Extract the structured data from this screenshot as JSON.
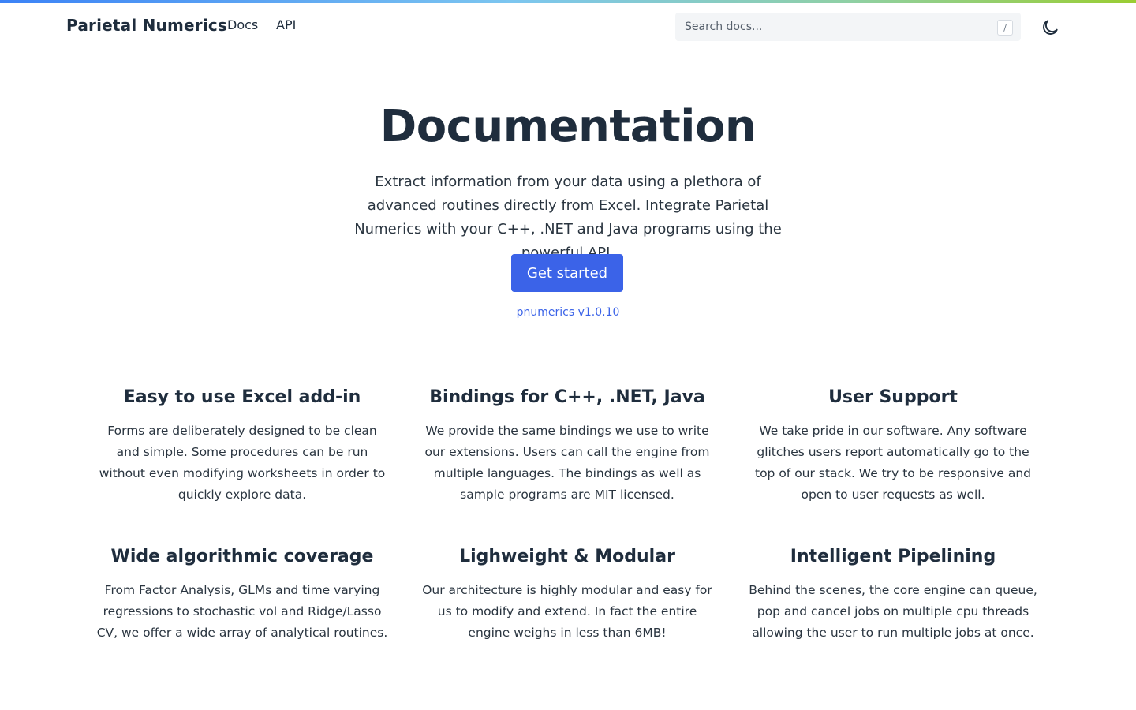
{
  "header": {
    "brand": "Parietal Numerics",
    "nav": [
      {
        "label": "Docs"
      },
      {
        "label": "API"
      }
    ],
    "search": {
      "placeholder": "Search docs...",
      "shortcut": "/"
    },
    "theme_toggle_icon": "moon-icon"
  },
  "hero": {
    "title": "Documentation",
    "lead": "Extract information from your data using a plethora of advanced routines directly from Excel. Integrate Parietal Numerics with your C++, .NET and Java programs using the powerful API.",
    "cta_label": "Get started",
    "version": "pnumerics v1.0.10"
  },
  "features": [
    {
      "title": "Easy to use Excel add-in",
      "text": "Forms are deliberately designed to be clean and simple. Some procedures can be run without even modifying worksheets in order to quickly explore data."
    },
    {
      "title": "Bindings for C++, .NET, Java",
      "text": "We provide the same bindings we use to write our extensions. Users can call the engine from multiple languages. The bindings as well as sample programs are MIT licensed."
    },
    {
      "title": "User Support",
      "text": "We take pride in our software. Any software glitches users report automatically go to the top of our stack. We try to be responsive and open to user requests as well."
    },
    {
      "title": "Wide algorithmic coverage",
      "text": "From Factor Analysis, GLMs and time varying regressions to stochastic vol and Ridge/Lasso CV, we offer a wide array of analytical routines."
    },
    {
      "title": "Lighweight & Modular",
      "text": "Our architecture is highly modular and easy for us to modify and extend. In fact the entire engine weighs in less than 6MB!"
    },
    {
      "title": "Intelligent Pipelining",
      "text": "Behind the scenes, the core engine can queue, pop and cancel jobs on multiple cpu threads allowing the user to run multiple jobs at once."
    }
  ],
  "colors": {
    "accent": "#3b63e8",
    "text": "#1f2d3d",
    "search_bg": "#f3f5f7"
  }
}
